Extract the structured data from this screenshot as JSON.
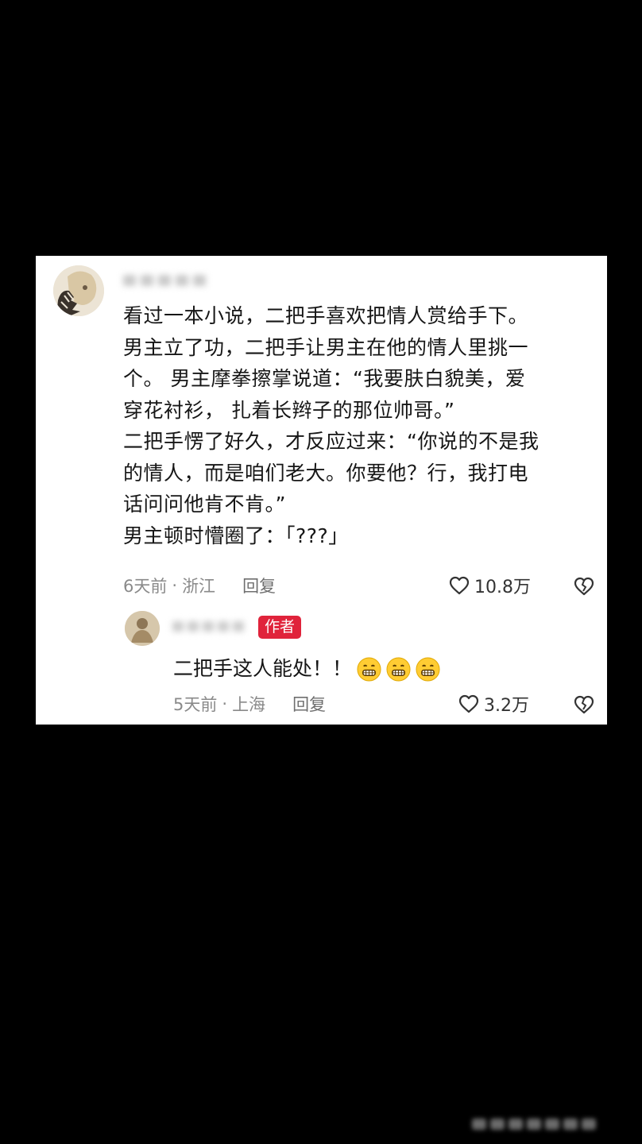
{
  "comment": {
    "lines": [
      "看过一本小说，二把手喜欢把情人赏给手下。",
      "男主立了功，二把手让男主在他的情人里挑一",
      "个。 男主摩拳擦掌说道：“我要肤白貌美，爱",
      "穿花衬衫， 扎着长辫子的那位帅哥。”",
      "二把手愣了好久，才反应过来：“你说的不是我",
      "的情人，而是咱们老大。你要他？行，我打电",
      "话问问他肯不肯。”",
      "男主顿时懵圈了：「???」"
    ],
    "time": "6天前",
    "separator": "·",
    "location": "浙江",
    "reply_label": "回复",
    "likes": "10.8万"
  },
  "reply": {
    "badge": "作者",
    "text": "二把手这人能处！！",
    "emoji_icons": [
      "grinning-face-icon",
      "grinning-face-icon",
      "grinning-face-icon"
    ],
    "time": "5天前",
    "separator": "·",
    "location": "上海",
    "reply_label": "回复",
    "likes": "3.2万"
  },
  "colors": {
    "badge": "#e0233b",
    "text": "#161616",
    "meta": "#8a8a8a"
  }
}
